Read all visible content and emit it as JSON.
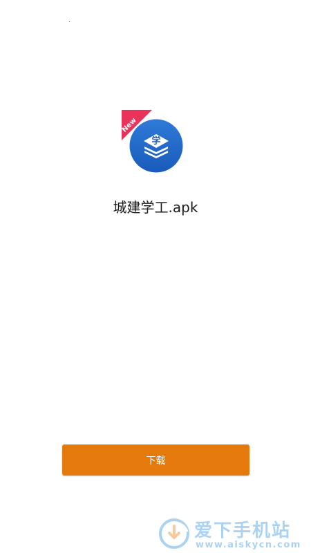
{
  "app": {
    "badge_text": "New",
    "icon_glyph": "学",
    "icon_name": "app-icon",
    "file_name": "城建学工.apk"
  },
  "actions": {
    "download_label": "下载"
  },
  "watermark": {
    "title": "爱下手机站",
    "url": "www.aiskycn.com"
  },
  "colors": {
    "accent": "#e47a0b",
    "icon_blue": "#1a5fc0",
    "badge_red": "#e8335a",
    "watermark_blue": "#6aaee6"
  }
}
